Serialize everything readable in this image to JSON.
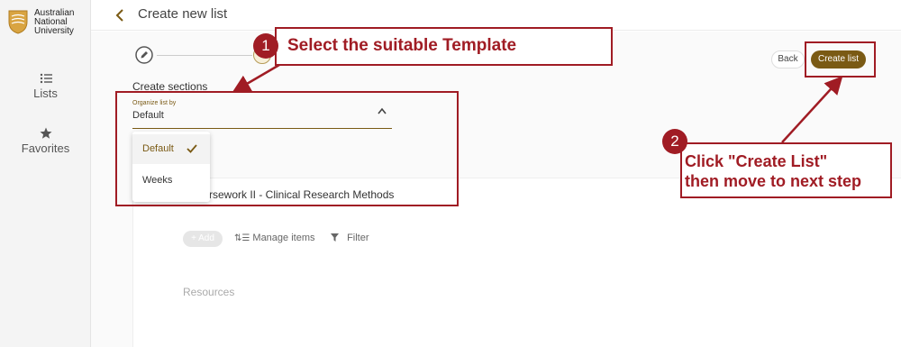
{
  "sidebar": {
    "logo_lines": [
      "Australian",
      "National",
      "University"
    ],
    "items": [
      {
        "label": "Lists",
        "icon": "list-icon"
      },
      {
        "label": "Favorites",
        "icon": "star-icon"
      }
    ]
  },
  "header": {
    "title": "Create new list",
    "back_icon": "chevron-left-icon"
  },
  "actions": {
    "back_label": "Back",
    "create_label": "Create list"
  },
  "form": {
    "section_label": "Create sections",
    "organize": {
      "label": "Organize list by",
      "value": "Default",
      "options": [
        "Default",
        "Weeks"
      ]
    }
  },
  "course": {
    "title_visible": "rsework II - Clinical Research Methods"
  },
  "toolbar": {
    "add_label": "+ Add",
    "manage_label": "Manage items",
    "filter_label": "Filter"
  },
  "resources_label": "Resources",
  "annotations": {
    "step1": {
      "number": "1",
      "text": "Select the suitable Template"
    },
    "step2": {
      "number": "2",
      "line1": "Click \"Create List\"",
      "line2": "then move to next step"
    },
    "color": "#a01c24"
  },
  "colors": {
    "accent": "#7a5a14",
    "annotation": "#a01c24"
  }
}
